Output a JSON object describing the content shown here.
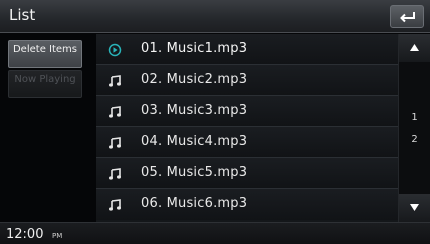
{
  "header": {
    "title": "List",
    "back_icon": "back-return-icon"
  },
  "menu": {
    "delete_label": "Delete Items",
    "now_playing_label": "Now Playing"
  },
  "tracks": [
    {
      "name": "01. Music1.mp3",
      "icon": "play-circle-icon",
      "playing": true
    },
    {
      "name": "02. Music2.mp3",
      "icon": "music-note-icon",
      "playing": false
    },
    {
      "name": "03. Music3.mp3",
      "icon": "music-note-icon",
      "playing": false
    },
    {
      "name": "04. Music4.mp3",
      "icon": "music-note-icon",
      "playing": false
    },
    {
      "name": "05. Music5.mp3",
      "icon": "music-note-icon",
      "playing": false
    },
    {
      "name": "06. Music6.mp3",
      "icon": "music-note-icon",
      "playing": false
    }
  ],
  "scroll": {
    "current_page": "1",
    "total_pages": "2"
  },
  "status": {
    "time": "12:00",
    "ampm": "PM"
  },
  "colors": {
    "accent": "#29b3b9"
  }
}
